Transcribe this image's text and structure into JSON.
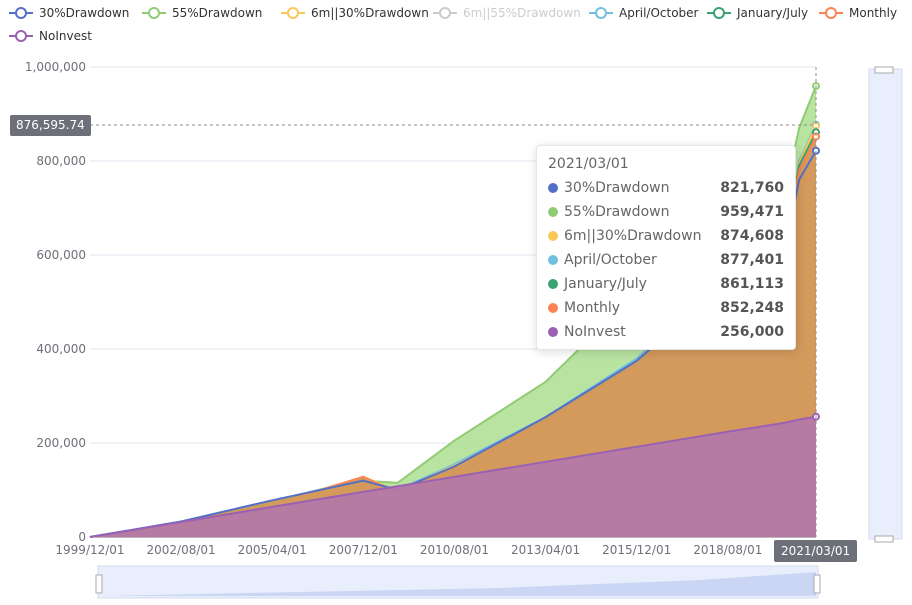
{
  "legend": [
    {
      "name": "30%Drawdown",
      "color": "#5470c6",
      "active": true
    },
    {
      "name": "55%Drawdown",
      "color": "#91cc75",
      "active": true
    },
    {
      "name": "6m||30%Drawdown",
      "color": "#fac858",
      "active": true
    },
    {
      "name": "6m||55%Drawdown",
      "color": "#cccccc",
      "active": false
    },
    {
      "name": "April/October",
      "color": "#73c0de",
      "active": true
    },
    {
      "name": "January/July",
      "color": "#3ba272",
      "active": true
    },
    {
      "name": "Monthly",
      "color": "#fc8452",
      "active": true
    },
    {
      "name": "NoInvest",
      "color": "#9a60b4",
      "active": true
    }
  ],
  "pointer": {
    "y_label": "876,595.74",
    "x_label": "2021/03/01"
  },
  "tooltip": {
    "date": "2021/03/01",
    "rows": [
      {
        "name": "30%Drawdown",
        "value": "821,760",
        "color": "#5470c6"
      },
      {
        "name": "55%Drawdown",
        "value": "959,471",
        "color": "#91cc75"
      },
      {
        "name": "6m||30%Drawdown",
        "value": "874,608",
        "color": "#fac858"
      },
      {
        "name": "April/October",
        "value": "877,401",
        "color": "#73c0de"
      },
      {
        "name": "January/July",
        "value": "861,113",
        "color": "#3ba272"
      },
      {
        "name": "Monthly",
        "value": "852,248",
        "color": "#fc8452"
      },
      {
        "name": "NoInvest",
        "value": "256,000",
        "color": "#9a60b4"
      }
    ]
  },
  "chart_data": {
    "type": "area",
    "ylim": [
      0,
      1000000
    ],
    "yticks": [
      "0",
      "200,000",
      "400,000",
      "600,000",
      "800,000",
      "1,000,000"
    ],
    "xticks": [
      "1999/12/01",
      "2002/08/01",
      "2005/04/01",
      "2007/12/01",
      "2010/08/01",
      "2013/04/01",
      "2015/12/01",
      "2018/08/01",
      "2021/03/01"
    ],
    "x": [
      "1999/12/01",
      "2002/08/01",
      "2005/04/01",
      "2007/12/01",
      "2008/12/01",
      "2010/08/01",
      "2013/04/01",
      "2015/12/01",
      "2017/06/01",
      "2018/08/01",
      "2020/03/01",
      "2020/09/01",
      "2021/03/01"
    ],
    "series": [
      {
        "name": "55%Drawdown",
        "color": "#91cc75",
        "values": [
          0,
          30000,
          70000,
          120000,
          115000,
          205000,
          330000,
          520000,
          640000,
          690000,
          700000,
          870000,
          959471
        ]
      },
      {
        "name": "April/October",
        "color": "#73c0de",
        "values": [
          0,
          33000,
          75000,
          125000,
          100000,
          155000,
          255000,
          380000,
          480000,
          560000,
          600000,
          800000,
          877401
        ]
      },
      {
        "name": "6m||30%Drawdown",
        "color": "#fac858",
        "values": [
          0,
          30000,
          70000,
          128000,
          98000,
          152000,
          250000,
          375000,
          475000,
          555000,
          590000,
          795000,
          874608
        ]
      },
      {
        "name": "January/July",
        "color": "#3ba272",
        "values": [
          0,
          30000,
          70000,
          125000,
          97000,
          150000,
          248000,
          370000,
          470000,
          550000,
          585000,
          790000,
          861113
        ]
      },
      {
        "name": "Monthly",
        "color": "#fc8452",
        "values": [
          0,
          28000,
          68000,
          128000,
          95000,
          148000,
          245000,
          365000,
          465000,
          545000,
          575000,
          780000,
          852248
        ]
      },
      {
        "name": "30%Drawdown",
        "color": "#5470c6",
        "values": [
          0,
          33000,
          78000,
          120000,
          100000,
          150000,
          255000,
          375000,
          470000,
          545000,
          570000,
          760000,
          821760
        ]
      },
      {
        "name": "NoInvest",
        "color": "#9a60b4",
        "values": [
          0,
          32000,
          64000,
          96000,
          108000,
          128000,
          160000,
          192000,
          210000,
          224000,
          242000,
          250000,
          256000
        ]
      }
    ]
  }
}
